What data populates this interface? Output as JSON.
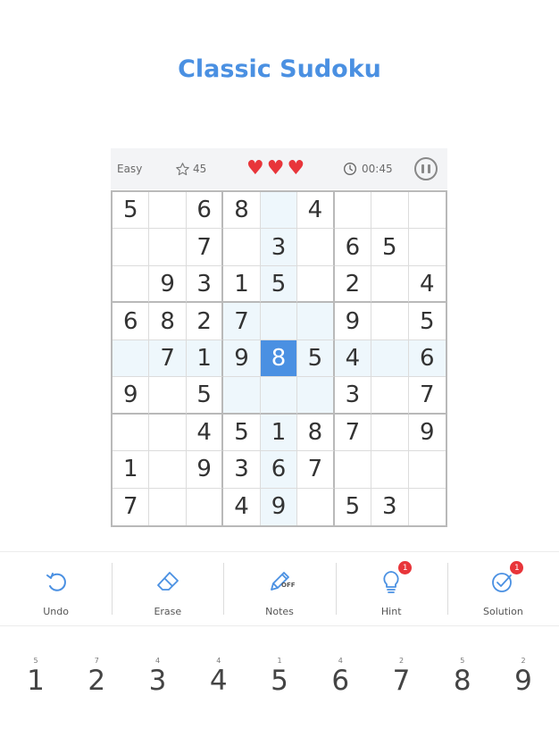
{
  "header": {
    "title": "Classic Sudoku"
  },
  "status": {
    "difficulty": "Easy",
    "score": "45",
    "lives": 3,
    "time": "00:45",
    "heart_color": "#e8353a"
  },
  "board": {
    "selected": [
      4,
      4
    ],
    "cells": [
      [
        "5",
        "",
        "6",
        "8",
        "",
        "4",
        "",
        "",
        ""
      ],
      [
        "",
        "",
        "7",
        "",
        "3",
        "",
        "6",
        "5",
        ""
      ],
      [
        "",
        "9",
        "3",
        "1",
        "5",
        "",
        "2",
        "",
        "4"
      ],
      [
        "6",
        "8",
        "2",
        "7",
        "",
        "",
        "9",
        "",
        "5"
      ],
      [
        "",
        "7",
        "1",
        "9",
        "8",
        "5",
        "4",
        "",
        "6"
      ],
      [
        "9",
        "",
        "5",
        "",
        "",
        "",
        "3",
        "",
        "7"
      ],
      [
        "",
        "",
        "4",
        "5",
        "1",
        "8",
        "7",
        "",
        "9"
      ],
      [
        "1",
        "",
        "9",
        "3",
        "6",
        "7",
        "",
        "",
        ""
      ],
      [
        "7",
        "",
        "",
        "4",
        "9",
        "",
        "5",
        "3",
        ""
      ]
    ]
  },
  "toolbar": {
    "undo": "Undo",
    "erase": "Erase",
    "notes": "Notes",
    "notes_state": "OFF",
    "hint": "Hint",
    "hint_badge": "1",
    "solution": "Solution",
    "solution_badge": "1",
    "accent": "#4a90e2"
  },
  "numpad": [
    {
      "digit": "1",
      "remaining": "5"
    },
    {
      "digit": "2",
      "remaining": "7"
    },
    {
      "digit": "3",
      "remaining": "4"
    },
    {
      "digit": "4",
      "remaining": "4"
    },
    {
      "digit": "5",
      "remaining": "1"
    },
    {
      "digit": "6",
      "remaining": "4"
    },
    {
      "digit": "7",
      "remaining": "2"
    },
    {
      "digit": "8",
      "remaining": "5"
    },
    {
      "digit": "9",
      "remaining": "2"
    }
  ]
}
